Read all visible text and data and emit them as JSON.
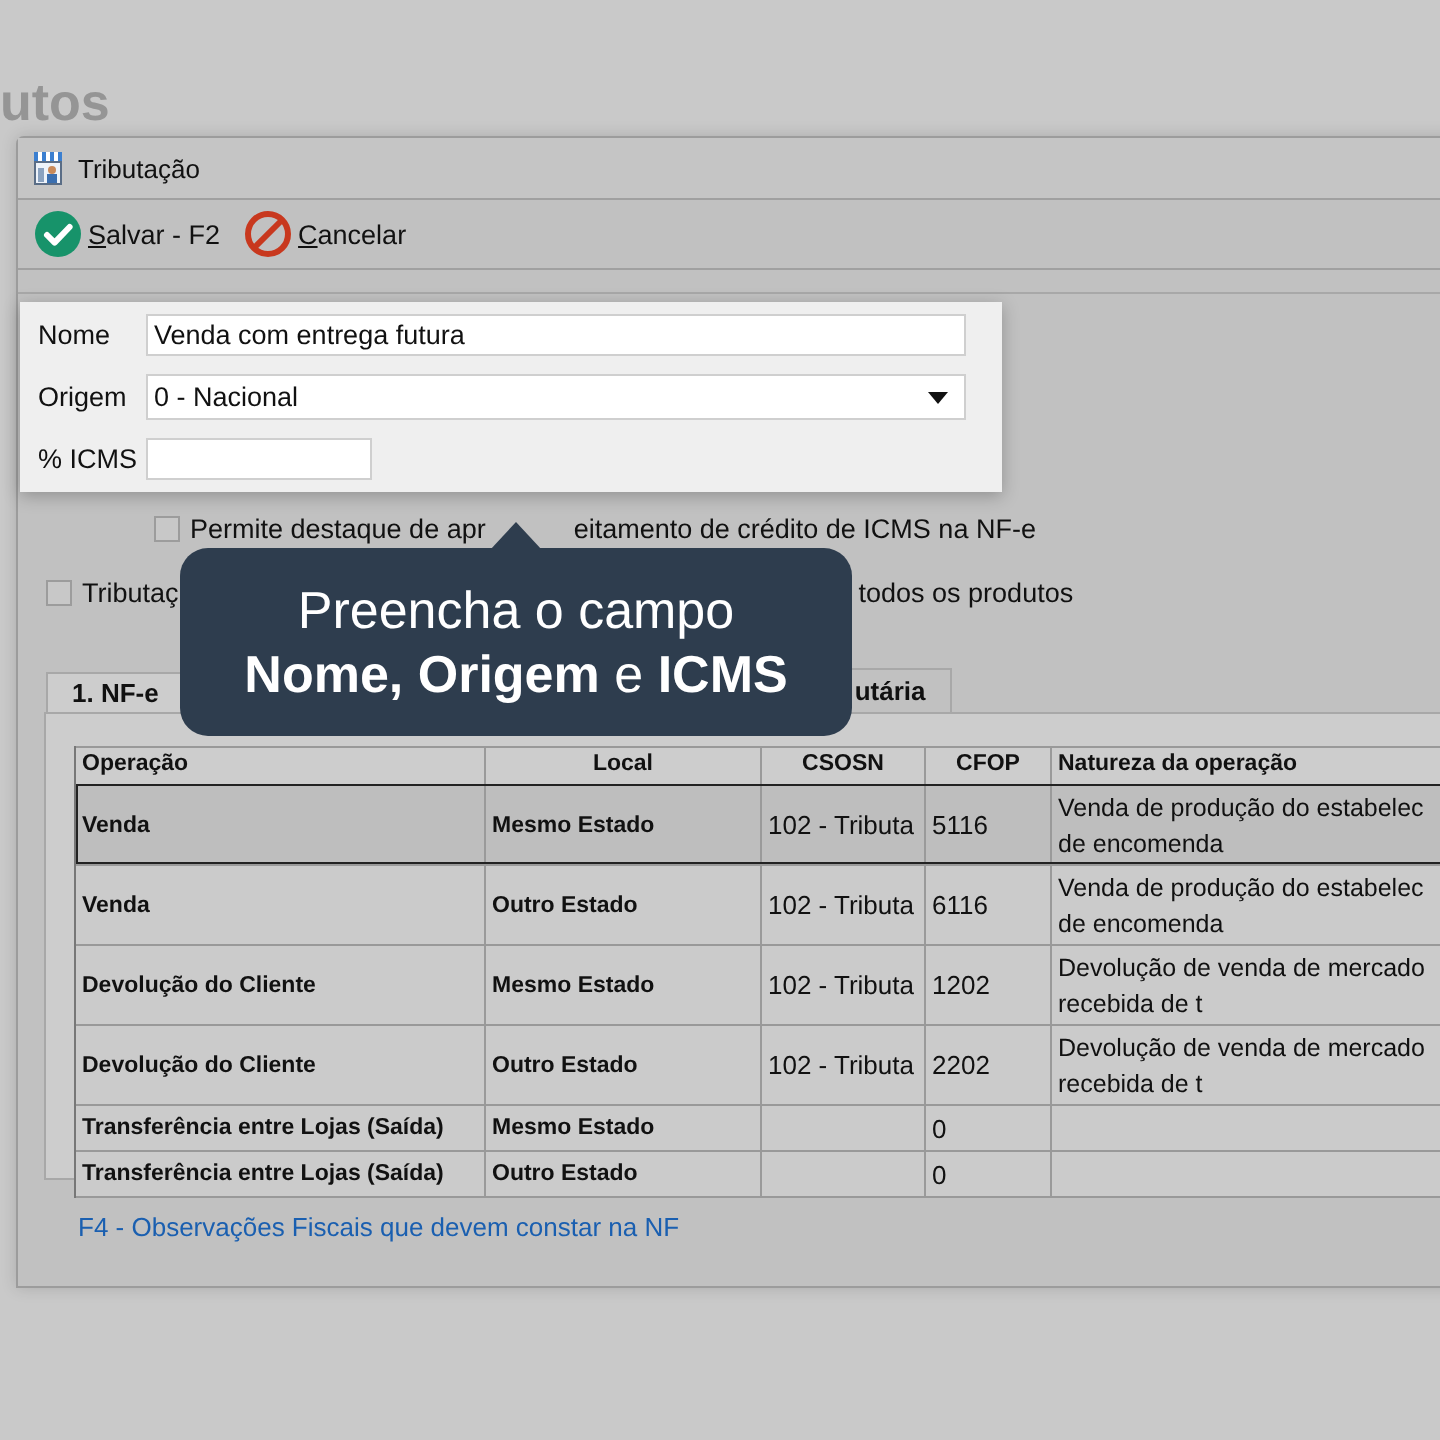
{
  "background_title": "utos",
  "window": {
    "title": "Tributação"
  },
  "toolbar": [
    {
      "label": "Salvar - F2",
      "kind": "save"
    },
    {
      "label": "Cancelar",
      "kind": "cancel"
    }
  ],
  "form": {
    "fields": [
      {
        "label": "Nome",
        "value": "Venda com entrega futura",
        "kind": "text"
      },
      {
        "label": "Origem",
        "value": "0 - Nacional",
        "kind": "select"
      },
      {
        "label": "% ICMS",
        "kind": "short"
      }
    ]
  },
  "checkboxes": [
    {
      "label_parts": [
        "Permite destaque de apr",
        "eitamento de crédito de ICMS na NF-e"
      ],
      "checked": false,
      "indented": true
    },
    {
      "label_parts": [
        "Tributaç",
        "todos os produtos"
      ],
      "checked": false,
      "indented": false
    }
  ],
  "tabs": [
    {
      "label": "1. NF-e",
      "selected": true
    },
    {
      "label": "utária",
      "selected": false
    }
  ],
  "table": {
    "columns": [
      "Operação",
      "Local",
      "CSOSN",
      "CFOP",
      "Natureza da operação"
    ],
    "rows": [
      {
        "cells": [
          "Venda",
          "Mesmo Estado",
          "102 - Tributa",
          "5116",
          "Venda de produção do estabelec\nde encomenda"
        ],
        "selected": true
      },
      {
        "cells": [
          "Venda",
          "Outro Estado",
          "102 - Tributa",
          "6116",
          "Venda de produção do estabelec\nde encomenda"
        ],
        "selected": false
      },
      {
        "cells": [
          "Devolução do Cliente",
          "Mesmo Estado",
          "102 - Tributa",
          "1202",
          "Devolução de venda de mercado\nrecebida de t"
        ],
        "selected": false
      },
      {
        "cells": [
          "Devolução do Cliente",
          "Outro Estado",
          "102 - Tributa",
          "2202",
          "Devolução de venda de mercado\nrecebida de t"
        ],
        "selected": false
      },
      {
        "cells": [
          "Transferência entre Lojas (Saída)",
          "Mesmo Estado",
          "",
          "0",
          ""
        ],
        "selected": false
      },
      {
        "cells": [
          "Transferência entre Lojas (Saída)",
          "Outro Estado",
          "",
          "0",
          ""
        ],
        "selected": false
      }
    ]
  },
  "footer_link": "F4 - Observações Fiscais que devem constar na NF",
  "tooltip": {
    "line_1": "Preencha o campo",
    "line_2": "**Nome, Origem** e **ICMS**"
  }
}
